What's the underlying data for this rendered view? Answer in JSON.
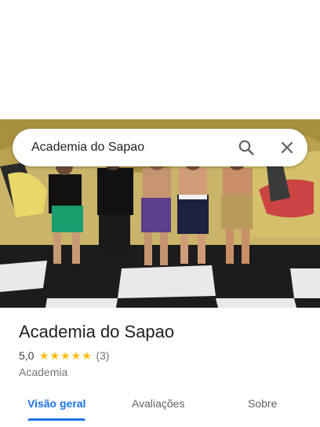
{
  "search": {
    "query": "Academia do Sapao",
    "search_icon": "search-icon",
    "close_icon": "close-icon"
  },
  "place": {
    "name": "Academia do Sapao",
    "rating_value": "5,0",
    "stars": [
      "★",
      "★",
      "★",
      "★",
      "★"
    ],
    "review_count": "(3)",
    "category": "Academia"
  },
  "tabs": [
    {
      "label": "Visão geral",
      "active": true
    },
    {
      "label": "Avaliações",
      "active": false
    },
    {
      "label": "Sobre",
      "active": false
    }
  ],
  "colors": {
    "accent": "#1a73e8",
    "star": "#fbbc04",
    "text_primary": "#202124",
    "text_secondary": "#70757a"
  }
}
